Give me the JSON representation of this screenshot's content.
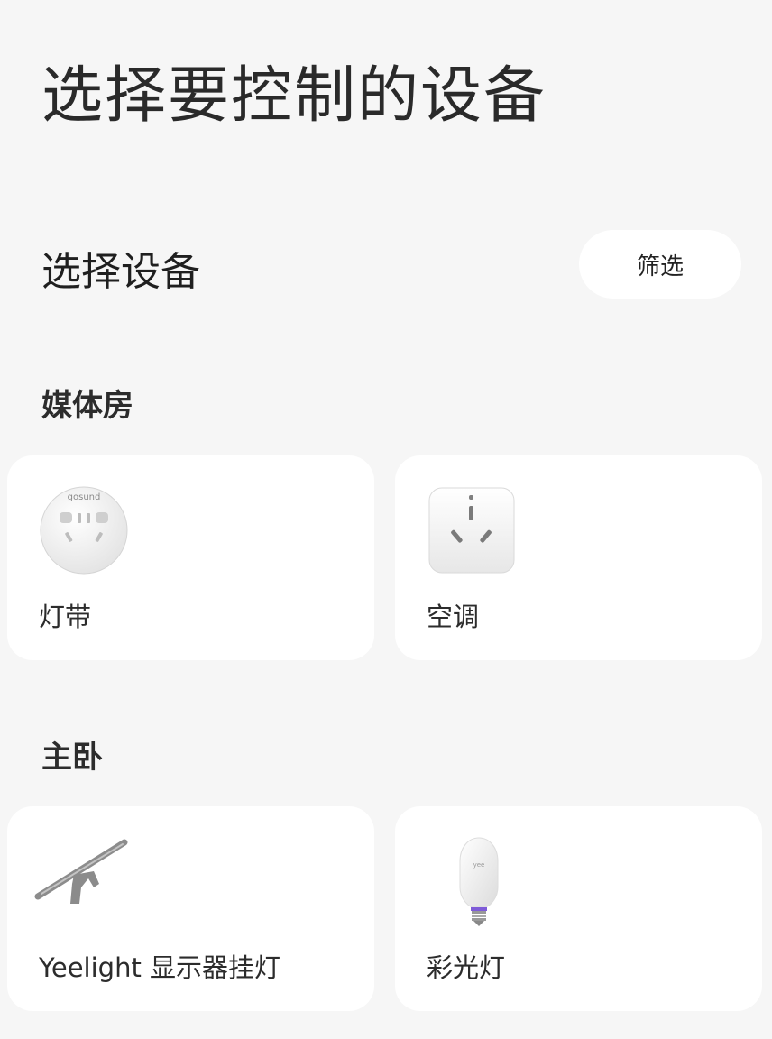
{
  "page": {
    "title": "选择要控制的设备"
  },
  "header": {
    "section_title": "选择设备",
    "filter_label": "筛选"
  },
  "rooms": [
    {
      "name": "媒体房",
      "devices": [
        {
          "name": "灯带",
          "icon": "gosund-round-plug-icon",
          "icon_text": "gosund"
        },
        {
          "name": "空调",
          "icon": "square-plug-icon"
        }
      ]
    },
    {
      "name": "主卧",
      "devices": [
        {
          "name": "Yeelight 显示器挂灯",
          "icon": "monitor-light-bar-icon"
        },
        {
          "name": "彩光灯",
          "icon": "bulb-icon"
        }
      ]
    }
  ],
  "colors": {
    "background": "#f6f6f6",
    "card": "#ffffff",
    "text": "#222222",
    "accent_purple": "#7e5bd8"
  }
}
